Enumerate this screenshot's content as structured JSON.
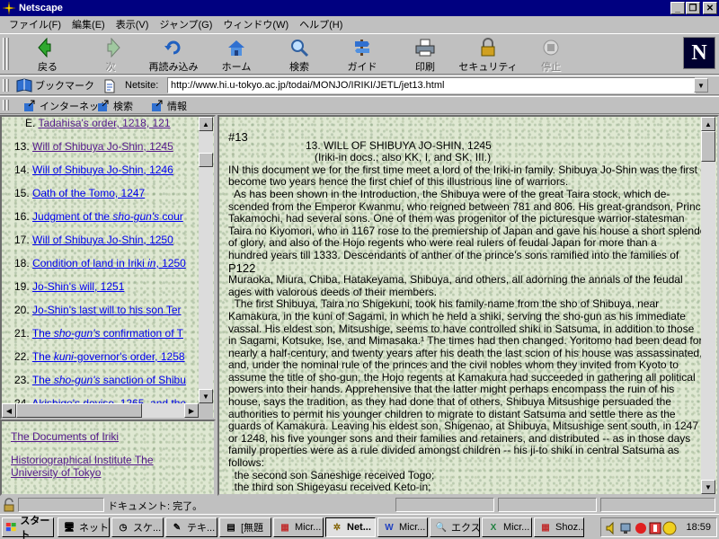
{
  "window": {
    "title": "Netscape"
  },
  "menu": [
    "ファイル(F)",
    "編集(E)",
    "表示(V)",
    "ジャンプ(G)",
    "ウィンドウ(W)",
    "ヘルプ(H)"
  ],
  "toolbar": {
    "back": "戻る",
    "forward": "次",
    "reload": "再読み込み",
    "home": "ホーム",
    "search": "検索",
    "guide": "ガイド",
    "print": "印刷",
    "security": "セキュリティ",
    "stop": "停止"
  },
  "location": {
    "bookmarks": "ブックマーク",
    "netsite_label": "Netsite:",
    "url": "http://www.hi.u-tokyo.ac.jp/todai/MONJO/IRIKI/JETL/jet13.html"
  },
  "personal": {
    "internet": "インターネット",
    "search": "検索",
    "info": "情報"
  },
  "left_list": [
    {
      "num": "E.",
      "text": "Tadahisa's order, 1218, 121"
    },
    {
      "num": "13.",
      "text": "Will of Shibuya Jo-Shin, 1245"
    },
    {
      "num": "14.",
      "text": "Will of Shibuya Jo-Shin, 1246"
    },
    {
      "num": "15.",
      "text": "Oath of the Tomo, 1247"
    },
    {
      "num": "16.",
      "pre": "Judgment of the ",
      "em": "sho-gun's",
      "post": " cour"
    },
    {
      "num": "17.",
      "text": "Will of Shibuya Jo-Shin, 1250"
    },
    {
      "num": "18.",
      "pre": "Condition of land in Iriki ",
      "em": "in",
      "post": ", 1250"
    },
    {
      "num": "19.",
      "text": "Jo-Shin's will, 1251"
    },
    {
      "num": "20.",
      "text": "Jo-Shin's last will to his son Ter"
    },
    {
      "num": "21.",
      "pre": "The ",
      "em": "sho-gun's",
      "post": " confirmation of T"
    },
    {
      "num": "22.",
      "pre": "The ",
      "em": "kuni",
      "post": "-governor's order, 1258"
    },
    {
      "num": "23.",
      "pre": "The ",
      "em": "sho-gun's",
      "post": " sanction of Shibu"
    },
    {
      "num": "24.",
      "text": "Akishige's devise, 1265, and the"
    }
  ],
  "left_bottom": {
    "link1": "The Documents of Iriki",
    "link2": "Historiographical Institute The University of Tokyo"
  },
  "main": {
    "doc_num": "#13",
    "heading": "13. WILL OF SHIBUYA JO-SHIN, 1245",
    "subheading": "(Iriki-in docs.; also KK, I, and SK, III.)",
    "lines": [
      "IN this document we for the first time meet a lord of the Iriki-in family. Shibuya Jo-Shin was the first of his house to",
      "become two years hence the first chief of this illustrious line of warriors.",
      "  As has been shown in the Introduction, the Shibuya were of the great Taira stock, which de-",
      "scended from the Emperor Kwanmu, who reigned between 781 and 806. His great-grandson, Prince",
      "Takamochi, had several sons. One of them was progenitor of the picturesque warrior-statesman",
      "Taira no Kiyomori, who in 1167 rose to the premiership of Japan and gave his house a short splendor",
      "of glory, and also of the Hojo regents who were real rulers of feudal Japan for more than a",
      "hundred years till 1333. Descendants of anther of the prince's sons ramified into the families of",
      "P122",
      "Muraoka, Miura, Chiba, Hatakeyama, Shibuya, and others, all adorning the annals of the feudal",
      "ages with valorous deeds of their members.",
      "  The first Shibuya, Taira no Shigekuni, took his family-name from the sho of Shibuya, near",
      "Kamakura, in the kuni of Sagami, in which he held a shiki, serving the sho-gun as his immediate",
      "vassal. His eldest son, Mitsushige, seems to have controlled shiki in Satsuma, in addition to those",
      "in Sagami, Kotsuke, Ise, and Mimasaka.¹ The times had then changed. Yoritomo had been dead for",
      "nearly a half-century, and twenty years after his death the last scion of his house was assassinated,",
      "and, under the nominal rule of the princes and the civil nobles whom they invited from Kyoto to",
      "assume the title of sho-gun, the Hojo regents at Kamakura had succeeded in gathering all political",
      "powers into their hands. Apprehensive that the latter might perhaps encompass the ruin of his",
      "house, says the tradition, as they had done that of others, Shibuya Mitsushige persuaded the",
      "authorities to permit his younger children to migrate to distant Satsuma and settle there as the",
      "guards of Kamakura. Leaving his eldest son, Shigenao, at Shibuya, Mitsushige sent south, in 1247",
      "or 1248, his five younger sons and their families and retainers, and distributed -- as in those days",
      "family properties were as a rule divided amongst children -- his ji-to shiki in central Satsuma as",
      "follows:",
      "  the second son Saneshige received Togo;",
      "  the third son Shigeyasu received Keto-in;"
    ]
  },
  "status": {
    "text": "ドキュメント: 完了。"
  },
  "taskbar": {
    "start": "スタート",
    "tasks": [
      "ネット...",
      "スケ...",
      "テキ...",
      "[無題",
      "Micr...",
      "Net...",
      "Micr...",
      "エクス...",
      "Micr...",
      "Shoz..."
    ],
    "clock": "18:59"
  }
}
